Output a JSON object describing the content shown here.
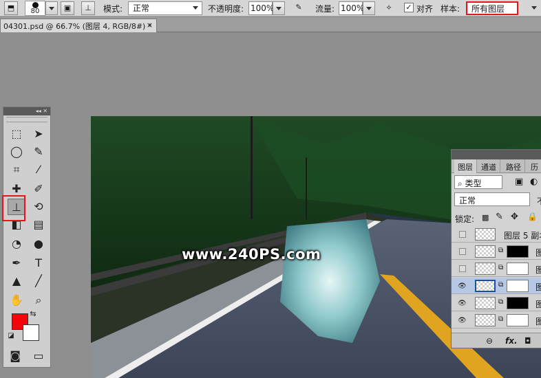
{
  "options_bar": {
    "brush_size": "80",
    "mode_label": "模式:",
    "mode_value": "正常",
    "opacity_label": "不透明度:",
    "opacity_value": "100%",
    "flow_label": "流量:",
    "flow_value": "100%",
    "aligned_label": "对齐",
    "aligned_checked": "✓",
    "sample_label": "样本:",
    "sample_value": "所有图层"
  },
  "document_tab": {
    "title": "04301.psd @ 66.7% (图层 4, RGB/8#) *",
    "close": "×"
  },
  "tools_panel": {
    "collapse": "◂◂ ✕",
    "colors": {
      "foreground": "#f2060a",
      "background": "#ffffff"
    }
  },
  "canvas": {
    "watermark": "www.240PS.com"
  },
  "layers_panel": {
    "tabs": [
      "图层",
      "通道",
      "路径",
      "历"
    ],
    "filter_value": "类型",
    "blend_value": "正常",
    "opacity_cut": "不",
    "lock_label": "锁定:",
    "layers": [
      {
        "name": "图层 5 副本",
        "visible": false
      },
      {
        "name": "图",
        "visible": false
      },
      {
        "name": "图",
        "visible": false
      },
      {
        "name": "图",
        "visible": true,
        "selected": true
      },
      {
        "name": "图",
        "visible": true
      },
      {
        "name": "图",
        "visible": true
      }
    ],
    "footer": {
      "link": "⊖",
      "fx": "fx.",
      "mask": "◘"
    }
  }
}
